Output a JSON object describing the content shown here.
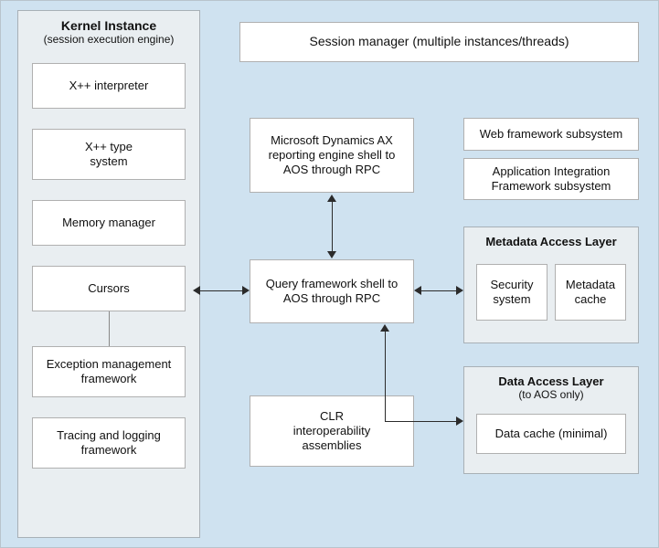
{
  "outer": {},
  "kernel": {
    "title": "Kernel Instance",
    "subtitle": "(session execution engine)",
    "items": [
      "X++ interpreter",
      "X++ type\nsystem",
      "Memory manager",
      "Cursors",
      "Exception management\nframework",
      "Tracing and logging\nframework"
    ]
  },
  "session_manager": "Session manager (multiple instances/threads)",
  "middle": {
    "reporting": "Microsoft Dynamics AX\nreporting engine shell to\nAOS through RPC",
    "query": "Query framework shell to\nAOS through RPC",
    "clr": "CLR\ninteroperability\nassemblies"
  },
  "right_top": {
    "web_framework": "Web framework subsystem",
    "aif": "Application Integration\nFramework subsystem"
  },
  "metadata_layer": {
    "title": "Metadata Access Layer",
    "security": "Security\nsystem",
    "cache": "Metadata\ncache"
  },
  "data_layer": {
    "title": "Data Access Layer",
    "subtitle": "(to AOS only)",
    "cache": "Data cache (minimal)"
  }
}
